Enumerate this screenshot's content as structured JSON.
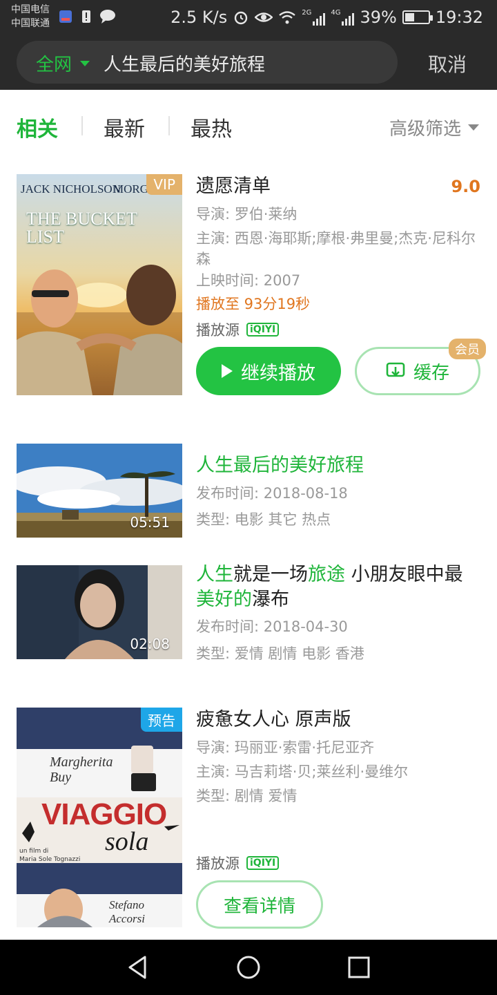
{
  "status_bar": {
    "carrier1": "中国电信",
    "carrier2": "中国联通",
    "speed": "2.5 K/s",
    "signal1": "2G",
    "signal2": "4G",
    "battery": "39%",
    "time": "19:32"
  },
  "search": {
    "scope_label": "全网",
    "query": "人生最后的美好旅程",
    "cancel_label": "取消"
  },
  "tabs": [
    {
      "label": "相关",
      "active": true
    },
    {
      "label": "最新",
      "active": false
    },
    {
      "label": "最热",
      "active": false
    }
  ],
  "filter_label": "高级筛选",
  "results": [
    {
      "badge": "VIP",
      "poster_top_left": "JACK NICHOLSON",
      "poster_top_right": "MORGAN FREEMAN",
      "poster_title": "THE BUCKET LIST",
      "title": "遗愿清单",
      "rating": "9.0",
      "director": "导演: 罗伯·莱纳",
      "cast": "主演: 西恩·海耶斯;摩根·弗里曼;杰克·尼科尔森",
      "release": "上映时间: 2007",
      "progress": "播放至 93分19秒",
      "source_label": "播放源",
      "source_icon": "iQIYI",
      "play_label": "继续播放",
      "cache_label": "缓存",
      "member_tag": "会员"
    },
    {
      "title": "人生最后的美好旅程",
      "date": "发布时间: 2018-08-18",
      "type": "类型: 电影 其它 热点",
      "duration": "05:51"
    },
    {
      "title_parts": [
        {
          "text": "人生",
          "highlight": true
        },
        {
          "text": "就是一场",
          "highlight": false
        },
        {
          "text": "旅途",
          "highlight": true
        },
        {
          "text": " 小朋友眼中最",
          "highlight": false
        },
        {
          "text": "美好的",
          "highlight": true
        },
        {
          "text": "瀑布",
          "highlight": false
        }
      ],
      "date": "发布时间: 2018-04-30",
      "type": "类型: 爱情 剧情 电影 香港",
      "duration": "02:08"
    },
    {
      "badge": "预告",
      "poster_title1": "VIAGGIO",
      "poster_title2": "sola",
      "poster_name1": "Margherita Buy",
      "poster_name2": "Stefano Accorsi",
      "poster_credit1": "un film di",
      "poster_credit2": "Maria Sole Tognazzi",
      "title": "疲惫女人心 原声版",
      "director": "导演: 玛丽亚·索雷·托尼亚齐",
      "cast": "主演: 马吉莉塔·贝;莱丝利·曼维尔",
      "type": "类型: 剧情 爱情",
      "source_label": "播放源",
      "source_icon": "iQIYI",
      "detail_label": "查看详情"
    }
  ],
  "colors": {
    "accent": "#23c343",
    "orange": "#e0761f",
    "vip": "#e4b26b",
    "trailer": "#1ea6e8"
  }
}
